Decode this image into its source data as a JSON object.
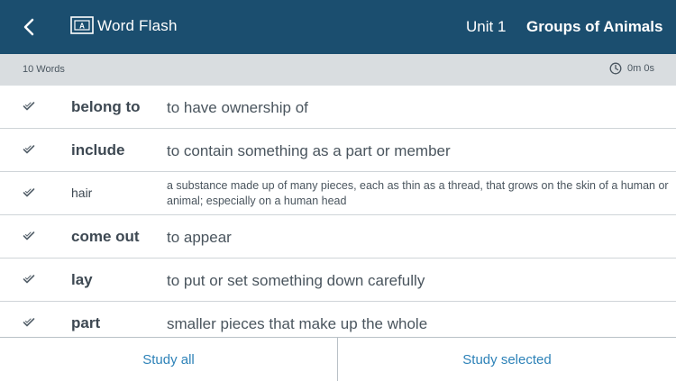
{
  "header": {
    "app_title": "Word Flash",
    "unit": "Unit 1",
    "topic": "Groups of Animals"
  },
  "subbar": {
    "word_count": "10 Words",
    "timer": "0m 0s"
  },
  "words": [
    {
      "term": "belong to",
      "definition": "to have ownership of"
    },
    {
      "term": "include",
      "definition": "to contain something as a part or member"
    },
    {
      "term": "hair",
      "definition": "a substance made up of many pieces, each as thin as a thread, that grows on the skin of a human or animal; especially on a human head"
    },
    {
      "term": "come out",
      "definition": "to appear"
    },
    {
      "term": "lay",
      "definition": "to put or set something down carefully"
    },
    {
      "term": "part",
      "definition": "smaller pieces that make up the whole"
    }
  ],
  "footer": {
    "study_all": "Study all",
    "study_selected": "Study selected"
  },
  "colors": {
    "header_bg": "#1b4e6f",
    "subbar_bg": "#d9dde0",
    "accent_link": "#2d82b8"
  },
  "icons": {
    "back": "chevron-left-icon",
    "logo": "flashcard-icon",
    "timer": "clock-icon",
    "check": "checkmark-icon"
  }
}
